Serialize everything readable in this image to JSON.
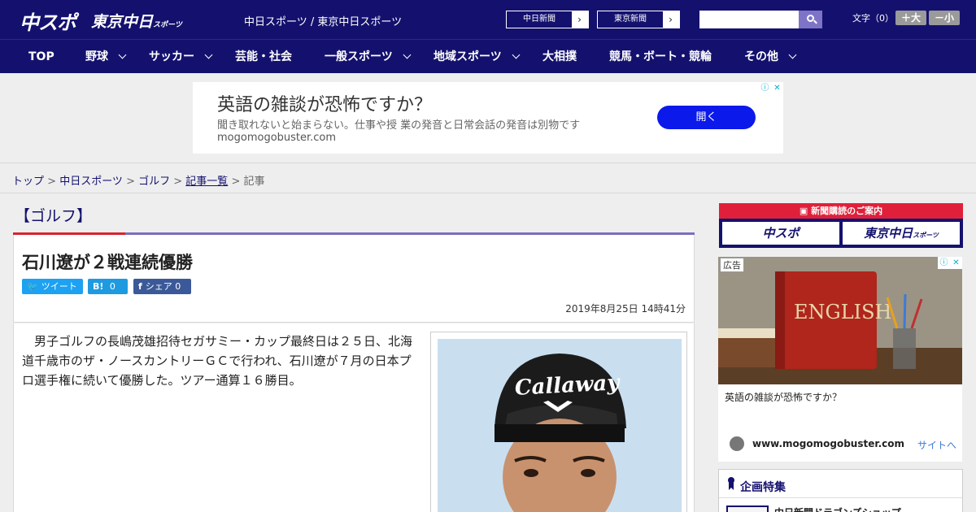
{
  "header": {
    "logo_chuspo": "中スポ",
    "logo_tokyo": "東京中日",
    "logo_tokyo_suffix": "スポーツ",
    "site_names": "中日スポーツ / 東京中日スポーツ",
    "link_chunichi": "中日新聞",
    "link_tokyo": "東京新聞",
    "font_size_label": "文字（0）",
    "font_larger": "＋大",
    "font_smaller": "－小"
  },
  "nav": {
    "items": [
      {
        "label": "TOP"
      },
      {
        "label": "野球"
      },
      {
        "label": "サッカー"
      },
      {
        "label": "芸能・社会"
      },
      {
        "label": "一般スポーツ"
      },
      {
        "label": "地域スポーツ"
      },
      {
        "label": "大相撲"
      },
      {
        "label": "競馬・ボート・競輪"
      },
      {
        "label": "その他"
      }
    ]
  },
  "top_ad": {
    "title": "英語の雑談が恐怖ですか？",
    "description": "聞き取れないと始まらない。仕事や授 業の発音と日常会話の発音は別物です",
    "domain": "mogomogobuster.com",
    "button": "開く"
  },
  "breadcrumb": {
    "top": "トップ",
    "sep": " > ",
    "chunichi_sports": "中日スポーツ",
    "golf": "ゴルフ",
    "list": "記事一覧",
    "current": "記事"
  },
  "article": {
    "category": "【ゴルフ】",
    "headline": "石川遼が２戦連続優勝",
    "share_tweet": "ツイート",
    "share_hatena_icon": "B!",
    "share_hatena_count": "0",
    "share_fb": "シェア",
    "share_fb_count": "0",
    "date": "2019年8月25日 14時41分",
    "body": "男子ゴルフの長嶋茂雄招待セガサミー・カップ最終日は２５日、北海道千歳市のザ・ノースカントリーＧＣで行われ、石川遼が７月の日本プロ選手権に続いて優勝した。ツアー通算１６勝目。"
  },
  "sidebar": {
    "subscription_title": "新聞購読のご案内",
    "sub_logo_chuspo": "中スポ",
    "sub_logo_tokyo": "東京中日",
    "sub_logo_tokyo_suffix": "スポーツ",
    "ad_label": "広告",
    "ad_title": "英語の雑談が恐怖ですか？",
    "ad_domain": "www.mogomogobuster.com",
    "ad_link": "サイトへ",
    "ad_image_text": "ENGLISH",
    "kikaku_title": "企画特集",
    "kikaku_item": "中日新聞ドラゴンズショップ"
  },
  "colors": {
    "brand_navy": "#14116e",
    "accent_red": "#d5242f",
    "accent_purple": "#7a6fbf",
    "ad_button_blue": "#0b19ea"
  }
}
